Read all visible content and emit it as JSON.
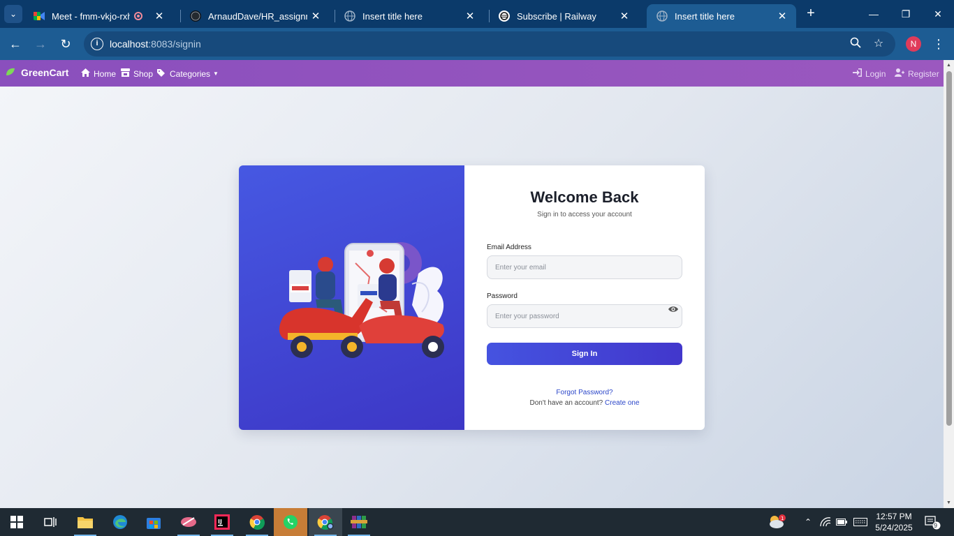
{
  "browser": {
    "tabs": [
      {
        "title": "Meet - fmm-vkjo-rxh",
        "icon": "google-meet-icon",
        "recording": true
      },
      {
        "title": "ArnaudDave/HR_assignment",
        "icon": "github-icon"
      },
      {
        "title": "Insert title here",
        "icon": "globe-icon"
      },
      {
        "title": "Subscribe | Railway",
        "icon": "railway-icon"
      },
      {
        "title": "Insert title here",
        "icon": "globe-icon",
        "active": true
      }
    ],
    "url_host": "localhost",
    "url_rest": ":8083/signin",
    "profile_initial": "N"
  },
  "navbar": {
    "brand": "GreenCart",
    "links": [
      "Home",
      "Shop",
      "Categories"
    ],
    "right_links": [
      "Login",
      "Register"
    ]
  },
  "login": {
    "title": "Welcome Back",
    "subtitle": "Sign in to access your account",
    "email_label": "Email Address",
    "email_placeholder": "Enter your email",
    "password_label": "Password",
    "password_placeholder": "Enter your password",
    "submit_label": "Sign In",
    "forgot_label": "Forgot Password?",
    "no_account_text": "Don't have an account?",
    "create_label": "Create one"
  },
  "taskbar": {
    "time": "12:57 PM",
    "date": "5/24/2025",
    "weather_badge": "1",
    "notification_count": "9"
  },
  "colors": {
    "navbar": "#8a4fbd",
    "accent": "#4237cc",
    "tab_strip": "#0b3a6a",
    "toolbar": "#1d5c93"
  }
}
